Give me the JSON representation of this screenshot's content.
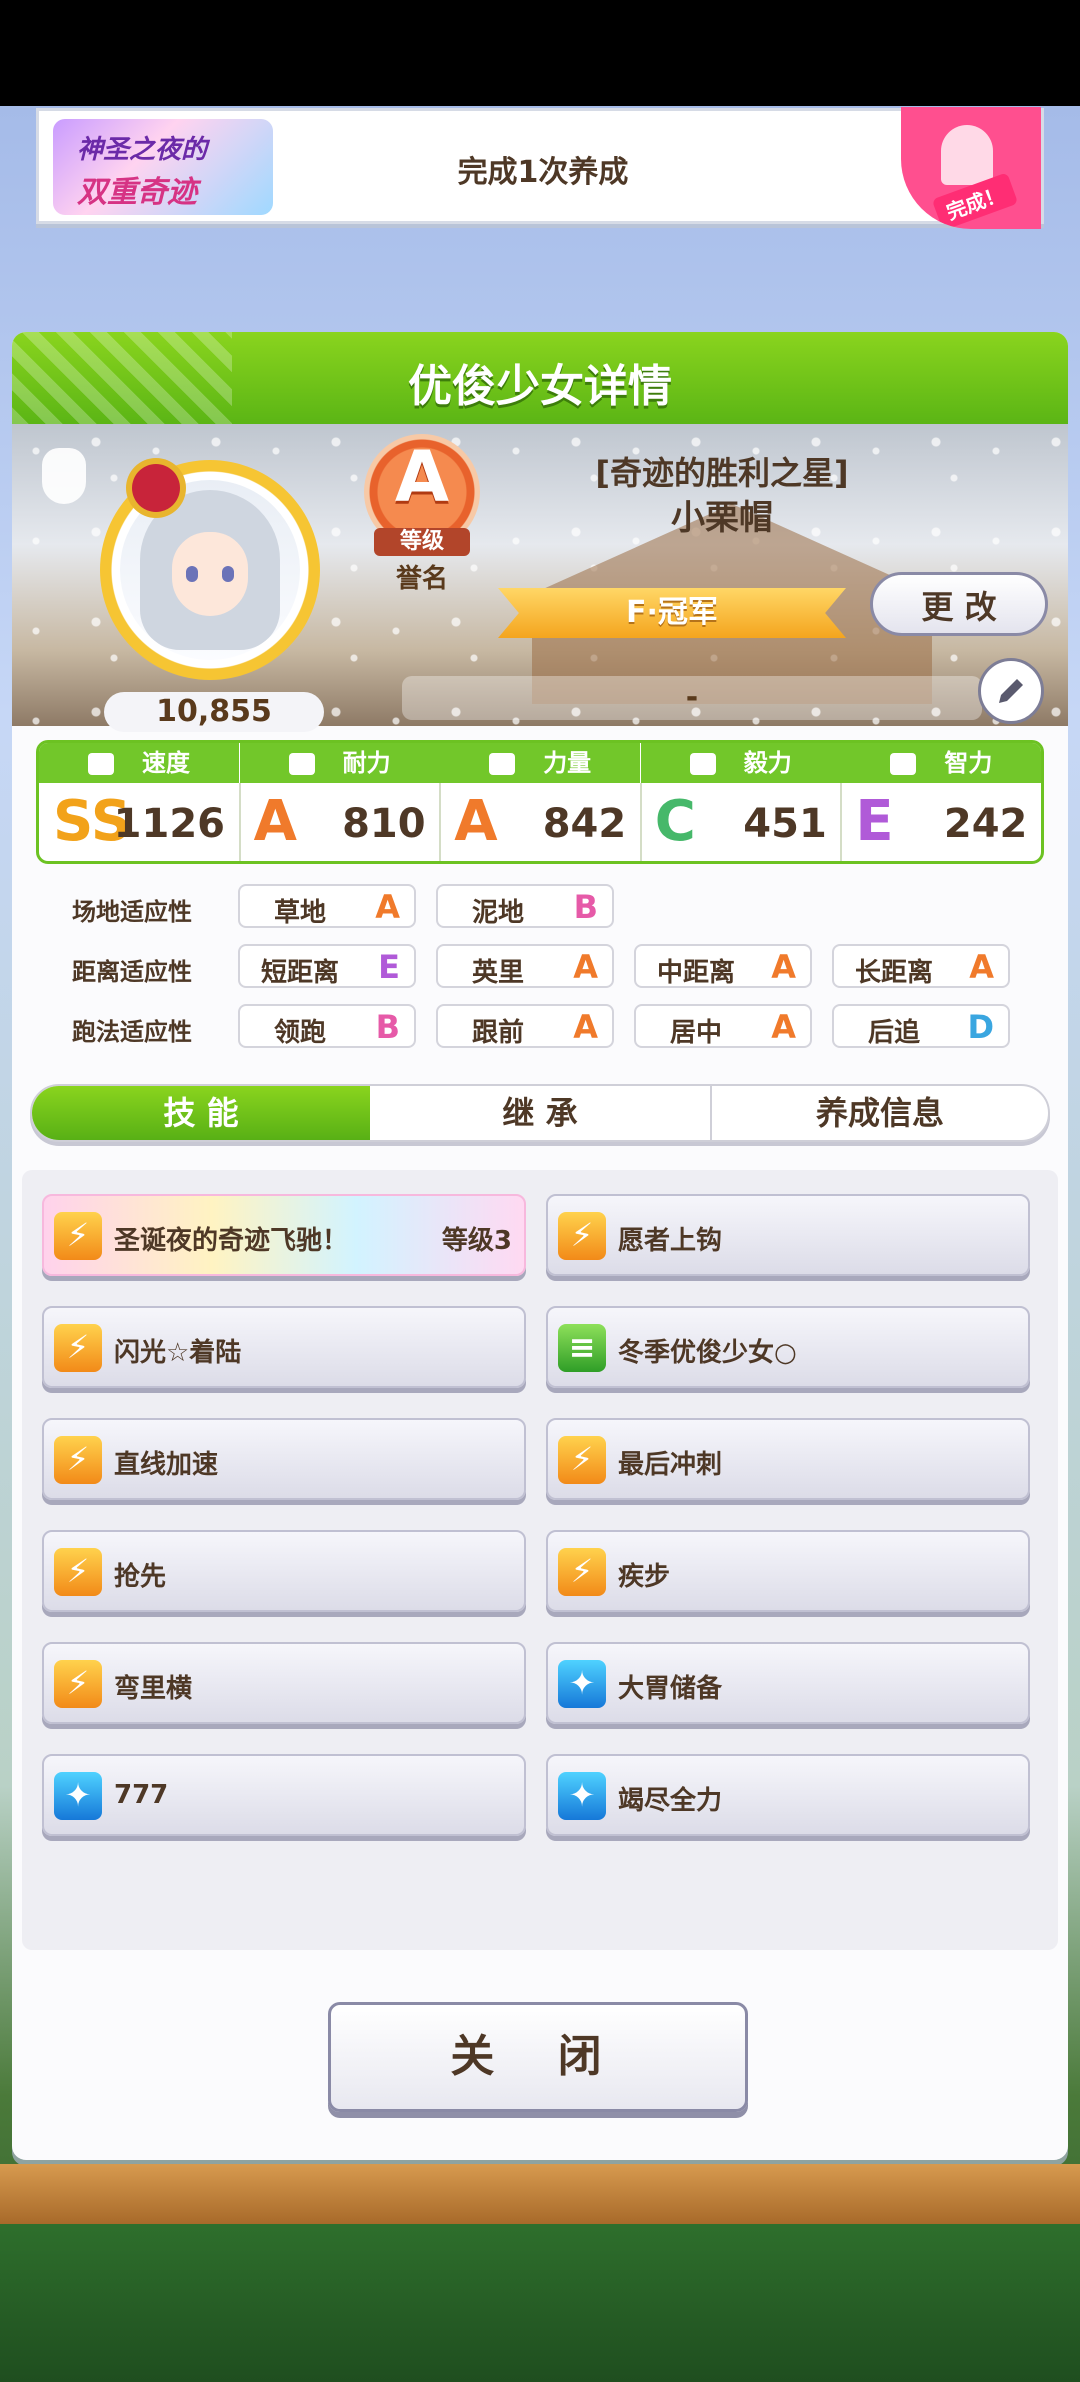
{
  "mission": {
    "logo_line1": "神圣之夜的",
    "logo_line2": "双重奇迹",
    "text": "完成1次养成",
    "stamp": "完成！"
  },
  "panel": {
    "title": "优俊少女详情"
  },
  "character": {
    "fans": "10,855",
    "rank_grade": "A",
    "rank_label": "等级",
    "rank_name": "誉名",
    "epithet": "[奇迹的胜利之星]",
    "name": "小栗帽",
    "title": "F·冠军",
    "change_label": "更 改",
    "memo": "-"
  },
  "stats": [
    {
      "label": "速度",
      "grade": "SS",
      "value": "1126",
      "color": "#f2a21a"
    },
    {
      "label": "耐力",
      "grade": "A",
      "value": "810",
      "color": "#f07a2b"
    },
    {
      "label": "力量",
      "grade": "A",
      "value": "842",
      "color": "#f07a2b"
    },
    {
      "label": "毅力",
      "grade": "C",
      "value": "451",
      "color": "#46b86a"
    },
    {
      "label": "智力",
      "grade": "E",
      "value": "242",
      "color": "#b05ad8"
    }
  ],
  "aptitude": {
    "rows": [
      {
        "label": "场地适应性",
        "items": [
          {
            "name": "草地",
            "grade": "A"
          },
          {
            "name": "泥地",
            "grade": "B"
          }
        ]
      },
      {
        "label": "距离适应性",
        "items": [
          {
            "name": "短距离",
            "grade": "E"
          },
          {
            "name": "英里",
            "grade": "A"
          },
          {
            "name": "中距离",
            "grade": "A"
          },
          {
            "name": "长距离",
            "grade": "A"
          }
        ]
      },
      {
        "label": "跑法适应性",
        "items": [
          {
            "name": "领跑",
            "grade": "B"
          },
          {
            "name": "跟前",
            "grade": "A"
          },
          {
            "name": "居中",
            "grade": "A"
          },
          {
            "name": "后追",
            "grade": "D"
          }
        ]
      }
    ],
    "grade_colors": {
      "A": "#f07a2b",
      "B": "#e65aa8",
      "C": "#46b86a",
      "D": "#3aa6e0",
      "E": "#b05ad8"
    }
  },
  "tabs": [
    "技 能",
    "继 承",
    "养成信息"
  ],
  "skills": [
    {
      "name": "圣诞夜的奇迹飞驰！",
      "level": "等级3",
      "icon": "gold",
      "rainbow": true
    },
    {
      "name": "愿者上钩",
      "level": "",
      "icon": "gold"
    },
    {
      "name": "闪光☆着陆",
      "level": "",
      "icon": "gold"
    },
    {
      "name": "冬季优俊少女○",
      "level": "",
      "icon": "green"
    },
    {
      "name": "直线加速",
      "level": "",
      "icon": "gold"
    },
    {
      "name": "最后冲刺",
      "level": "",
      "icon": "gold"
    },
    {
      "name": "抢先",
      "level": "",
      "icon": "gold"
    },
    {
      "name": "疾步",
      "level": "",
      "icon": "gold"
    },
    {
      "name": "弯里横",
      "level": "",
      "icon": "gold"
    },
    {
      "name": "大胃储备",
      "level": "",
      "icon": "blue"
    },
    {
      "name": "777",
      "level": "",
      "icon": "blue"
    },
    {
      "name": "竭尽全力",
      "level": "",
      "icon": "blue"
    }
  ],
  "close_label": "关 闭"
}
